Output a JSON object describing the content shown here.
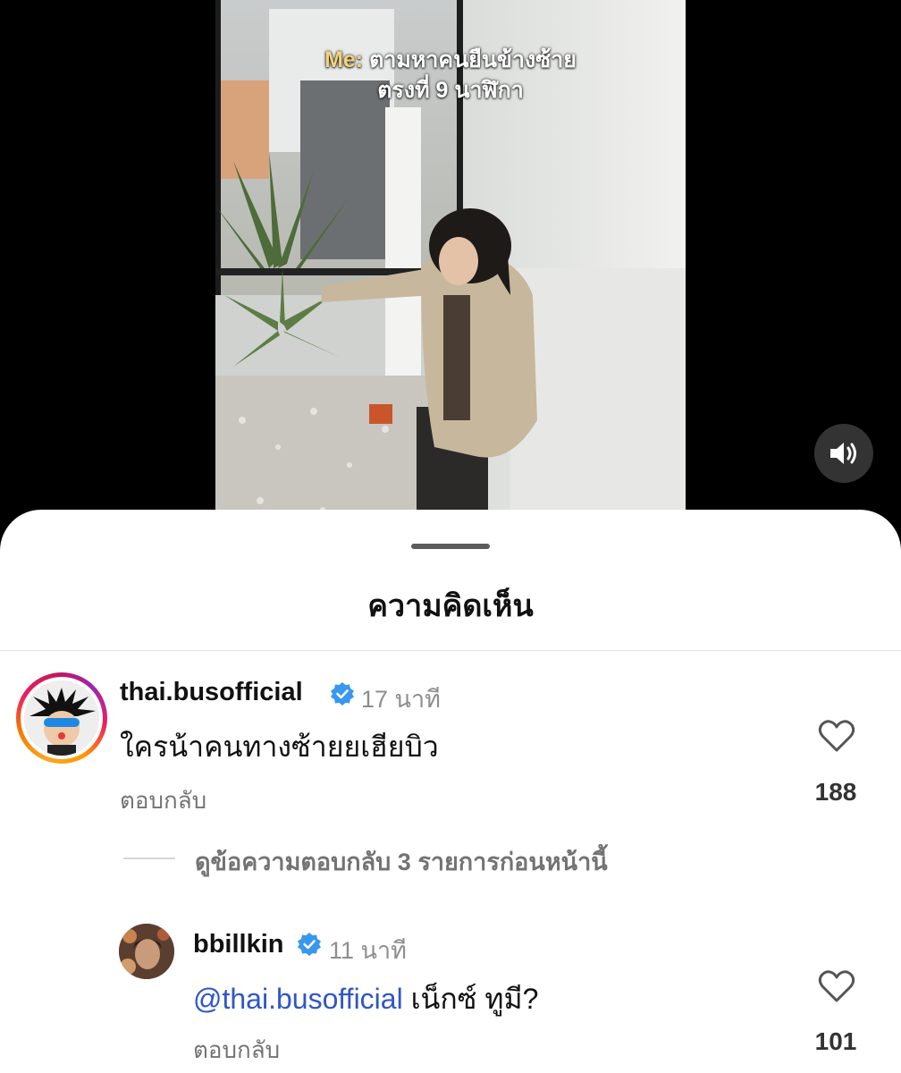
{
  "video": {
    "caption_prefix": "Me:",
    "caption_line1": "ตามหาคนยืนข้างซ้าย",
    "caption_line2": "ตรงที่ 9 นาฬิกา",
    "mute_icon": "speaker-icon"
  },
  "comments_sheet": {
    "title": "ความคิดเห็น",
    "comments": [
      {
        "username": "thai.busofficial",
        "verified": true,
        "time": "17 นาที",
        "text": "ใครน้าคนทางซ้ายยเฮียบิว",
        "reply_label": "ตอบกลับ",
        "likes": "188"
      }
    ],
    "view_previous_replies": "ดูข้อความตอบกลับ 3 รายการก่อนหน้านี้",
    "replies": [
      {
        "username": "bbillkin",
        "verified": true,
        "time": "11 นาที",
        "mention": "@thai.busofficial",
        "text": "เน็กซ์ ทูมี?",
        "reply_label": "ตอบกลับ",
        "likes": "101"
      }
    ]
  },
  "colors": {
    "verified_blue": "#3897f0",
    "mention_blue": "#3056c8",
    "sheet_background": "#ffffff",
    "backdrop": "#000000"
  }
}
